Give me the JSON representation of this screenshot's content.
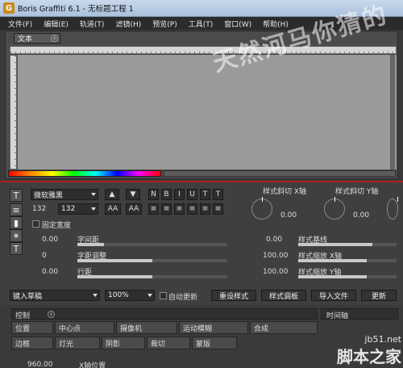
{
  "window": {
    "title": "Boris Graffiti 6.1 - 无标题工程 1",
    "logo": "G"
  },
  "menu": [
    "文件(F)",
    "编辑(E)",
    "轨道(T)",
    "滤镜(H)",
    "预览(P)",
    "工具(T)",
    "窗口(W)",
    "帮助(H)"
  ],
  "text_panel": {
    "tab_label": "文本",
    "watermark": "天然河马你猜的"
  },
  "style_panel": {
    "font_name": "微软雅黑",
    "font_size": "132",
    "font_size2": "132",
    "fixed_width_label": "固定宽度",
    "letter_spacing": {
      "label": "字间距",
      "value": "0.00"
    },
    "kerning": {
      "label": "字距调整",
      "value": "0"
    },
    "line_spacing": {
      "label": "行距",
      "value": "0.00"
    },
    "shear_x": {
      "label": "样式斜切 X轴",
      "value": "0.00"
    },
    "shear_y": {
      "label": "样式斜切 Y轴",
      "value": "0.00"
    },
    "baseline": {
      "label": "样式基线",
      "value": "0.00"
    },
    "scale_x": {
      "label": "样式缩放 X轴",
      "value": "100.00"
    },
    "scale_y": {
      "label": "样式缩放 Y轴",
      "value": "100.00"
    },
    "format_buttons": [
      "N",
      "B",
      "I",
      "U",
      "T",
      "T"
    ],
    "size_buttons": [
      "AA",
      "AA"
    ],
    "preset": "键入草稿",
    "zoom": "100%",
    "auto_update_label": "自动更新",
    "reset_style_label": "重设样式",
    "style_palette_label": "样式调板",
    "import_file_label": "导入文件",
    "update_label": "更新"
  },
  "control_panel": {
    "header": "控制",
    "timeline": "时间轴",
    "row1": [
      "位置",
      "中心点",
      "摄像机",
      "运动模糊",
      "合成"
    ],
    "row2": [
      "边框",
      "灯光",
      "阴影",
      "裁切",
      "蒙版"
    ],
    "bottom_value": "960.00",
    "bottom_label": "X轴位置"
  },
  "site_watermark": {
    "url": "jb51.net",
    "name": "脚本之家"
  }
}
